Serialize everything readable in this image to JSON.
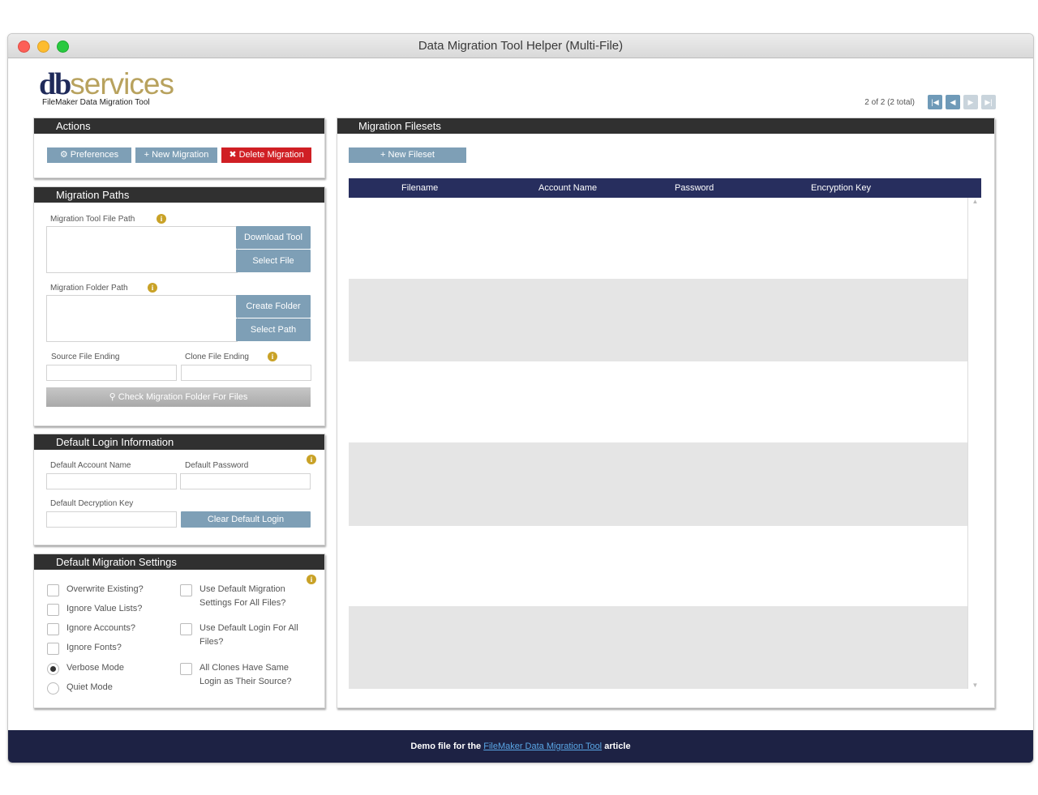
{
  "window": {
    "title": "Data Migration Tool Helper (Multi-File)"
  },
  "logo": {
    "brand_db": "db",
    "brand_services": "services",
    "subtitle": "FileMaker Data Migration Tool"
  },
  "pager": {
    "text": "2 of 2 (2 total)"
  },
  "actions": {
    "title": "Actions",
    "preferences": "Preferences",
    "new_migration": "New Migration",
    "delete_migration": "Delete Migration"
  },
  "paths": {
    "title": "Migration Paths",
    "tool_path_label": "Migration Tool File Path",
    "download_tool": "Download Tool",
    "select_file": "Select File",
    "folder_path_label": "Migration Folder Path",
    "create_folder": "Create Folder",
    "select_path": "Select Path",
    "source_ending_label": "Source File Ending",
    "clone_ending_label": "Clone File Ending",
    "check_button": "Check Migration Folder For Files"
  },
  "login": {
    "title": "Default Login Information",
    "account_label": "Default Account Name",
    "password_label": "Default Password",
    "decryption_label": "Default Decryption Key",
    "clear_button": "Clear Default Login"
  },
  "settings": {
    "title": "Default Migration Settings",
    "left_options": [
      "Overwrite Existing?",
      "Ignore Value Lists?",
      "Ignore Accounts?",
      "Ignore Fonts?"
    ],
    "verbose": "Verbose Mode",
    "quiet": "Quiet Mode",
    "right_options": [
      "Use Default Migration Settings For All Files?",
      "Use Default Login For All Files?",
      "All Clones Have Same Login as Their Source?"
    ]
  },
  "filesets": {
    "title": "Migration Filesets",
    "new_fileset": "New Fileset",
    "columns": [
      "Filename",
      "Account Name",
      "Password",
      "Encryption Key"
    ]
  },
  "footer": {
    "prefix": "Demo file for the ",
    "link": "FileMaker Data Migration Tool",
    "suffix": " article"
  }
}
